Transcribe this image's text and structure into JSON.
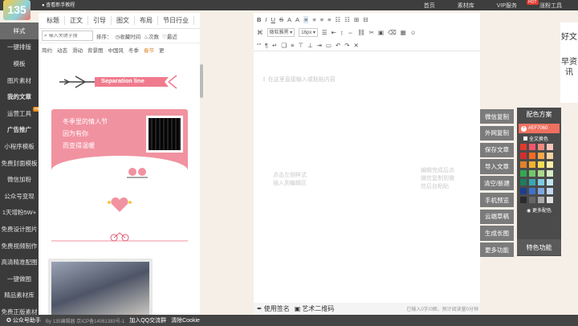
{
  "app": {
    "logo_text": "135",
    "tip": "查看新手教程"
  },
  "topnav": [
    {
      "label": "首页"
    },
    {
      "label": "素材库"
    },
    {
      "label": "VIP服务"
    },
    {
      "label": "涨粉工具"
    }
  ],
  "topnav_badge": "HOT",
  "sidebar": {
    "items": [
      {
        "label": "样式",
        "active": true
      },
      {
        "label": "一键排版"
      },
      {
        "label": "模板"
      },
      {
        "label": "图片素材"
      },
      {
        "label": "我的文章",
        "bold": true
      },
      {
        "label": "运营工具",
        "new": "new"
      },
      {
        "label": "广告推广",
        "bold": true
      },
      {
        "label": "小程序模板"
      },
      {
        "label": "免费封面模板"
      },
      {
        "label": "微信加粉"
      },
      {
        "label": "公众号变现"
      },
      {
        "label": "1天增粉5W+"
      },
      {
        "label": "免费设计图片"
      },
      {
        "label": "免费视频制作"
      },
      {
        "label": "高清精准配图"
      },
      {
        "label": "一键做图"
      },
      {
        "label": "精品素材库"
      },
      {
        "label": "免费正版素材"
      },
      {
        "label": "企业插件定制"
      }
    ]
  },
  "panel": {
    "tabs": [
      {
        "label": "标题"
      },
      {
        "label": "正文"
      },
      {
        "label": "引导"
      },
      {
        "label": "图文"
      },
      {
        "label": "布局"
      },
      {
        "label": "节日行业"
      }
    ],
    "search_placeholder": "输入关键字搜",
    "sort_label": "排序：",
    "sort_options": [
      {
        "label": "收藏时间"
      },
      {
        "label": "次数"
      },
      {
        "label": "最近"
      }
    ],
    "categories": [
      {
        "label": "简约"
      },
      {
        "label": "动态"
      },
      {
        "label": "滑动"
      },
      {
        "label": "背景图"
      },
      {
        "label": "中国风"
      },
      {
        "label": "冬季"
      },
      {
        "label": "春节",
        "on": true
      },
      {
        "label": "更"
      }
    ],
    "template1_text": "Separation line",
    "template2_lines": [
      "冬季里的情人节",
      "因为有你",
      "而变得温暖"
    ]
  },
  "editor": {
    "toolbar_row1": [
      "B",
      "I",
      "U",
      "S",
      "A",
      "A"
    ],
    "font_family": "微软雅黑",
    "font_size": "16px",
    "toolbar_row3": [
      "“”",
      "¶",
      "↵",
      "❏",
      "≡",
      "⊤",
      "⊥",
      "⇥",
      "▭",
      "↶",
      "↷",
      "✕"
    ],
    "placeholder": "在这里直接输入或粘贴内容",
    "hint_left": [
      "点击左侧样式",
      "插入到编辑区"
    ],
    "hint_right": [
      "编辑完成后点",
      "微信复制到微",
      "信后台粘贴"
    ],
    "bottom_sign": "使用签名",
    "bottom_qr": "艺术二维码",
    "word_count": "已输入0字/0图，预计阅读量0分钟"
  },
  "right_buttons": [
    {
      "label": "微信复制"
    },
    {
      "label": "外网复制"
    },
    {
      "label": "保存文章"
    },
    {
      "label": "导入文章"
    },
    {
      "label": "清空/新建"
    },
    {
      "label": "手机预览"
    },
    {
      "label": "云端草稿"
    },
    {
      "label": "生成长图"
    },
    {
      "label": "更多功能"
    }
  ],
  "color_panel": {
    "title": "配色方案",
    "hex": "#EF7060",
    "all_label": "全文换色",
    "more_label": "更多配色",
    "swatches": [
      "#e23b2e",
      "#f0566b",
      "#f08a7e",
      "#f7c5bb",
      "#d42d2d",
      "#f36c21",
      "#f7a94a",
      "#f7d3a3",
      "#e2822a",
      "#f3b12f",
      "#f4de55",
      "#f9f0a9",
      "#32a852",
      "#73c66b",
      "#a9d98b",
      "#d6ecc4",
      "#1e7d5d",
      "#38a7b3",
      "#7fcbe0",
      "#c0e7f1",
      "#1d3f8f",
      "#3e72c9",
      "#7ea7e0",
      "#c6d7f2",
      "#2b2b2b",
      "#666666",
      "#aaaaaa",
      "#e0e0e0"
    ]
  },
  "feature_label": "特色功能",
  "side_vertical": {
    "line1": "好文",
    "line2": "早资讯"
  },
  "footer": {
    "a": "公众号助手",
    "b": "By 135编辑器 京ICP备14061383号-1",
    "c": "加入QQ交流群",
    "d": "清除Cookie"
  }
}
